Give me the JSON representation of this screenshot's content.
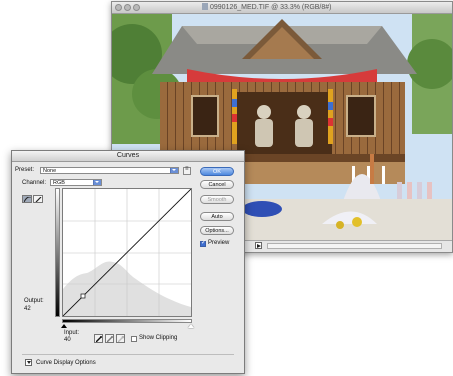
{
  "document": {
    "title": "0990126_MED.TIF @ 33.3% (RGB/8#)"
  },
  "curves": {
    "title": "Curves",
    "preset_label": "Preset:",
    "preset_value": "None",
    "channel_label": "Channel:",
    "channel_value": "RGB",
    "output_label": "Output:",
    "output_value": "42",
    "input_label": "Input:",
    "input_value": "40",
    "show_clipping_label": "Show Clipping",
    "show_clipping_checked": false,
    "preview_label": "Preview",
    "preview_checked": true,
    "display_options_label": "Curve Display Options",
    "buttons": {
      "ok": "OK",
      "cancel": "Cancel",
      "smooth": "Smooth",
      "auto": "Auto",
      "options": "Options..."
    },
    "control_point": {
      "input": 40,
      "output": 42
    },
    "colors": {
      "accent": "#4d88de"
    }
  },
  "icons": {
    "curve_mode": "curve-edit-icon",
    "pencil_mode": "pencil-icon",
    "eyedropper_black": "black-eyedropper-icon",
    "eyedropper_gray": "gray-eyedropper-icon",
    "eyedropper_white": "white-eyedropper-icon",
    "panel_menu": "panel-menu-icon"
  }
}
